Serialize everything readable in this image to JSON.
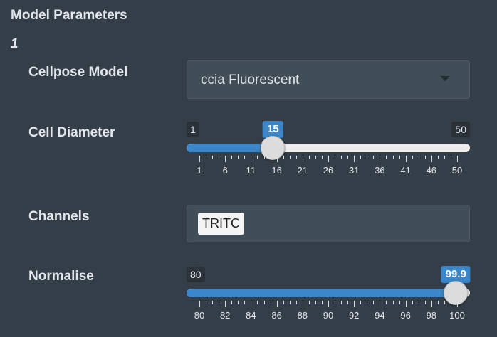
{
  "section": {
    "title": "Model Parameters",
    "index": "1"
  },
  "model": {
    "label": "Cellpose Model",
    "selected": "ccia Fluorescent",
    "icon": "chevron-down-icon"
  },
  "diameter": {
    "label": "Cell Diameter",
    "min": 1,
    "max": 50,
    "value": 15,
    "min_label": "1",
    "max_label": "50",
    "value_label": "15",
    "ticks": [
      "1",
      "6",
      "11",
      "16",
      "21",
      "26",
      "31",
      "36",
      "41",
      "46",
      "50"
    ],
    "fill_color": "#3c87c9"
  },
  "channels": {
    "label": "Channels",
    "chips": [
      "TRITC"
    ]
  },
  "normalise": {
    "label": "Normalise",
    "min": 80,
    "max": 100,
    "value": 99.9,
    "min_label": "80",
    "value_label": "99.9",
    "ticks": [
      "80",
      "82",
      "84",
      "86",
      "88",
      "90",
      "92",
      "94",
      "96",
      "98",
      "100"
    ],
    "fill_color": "#3c87c9"
  }
}
